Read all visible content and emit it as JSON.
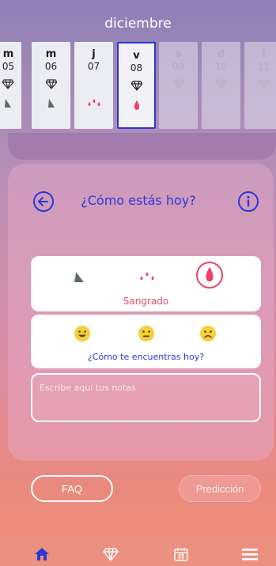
{
  "header": {
    "month": "diciembre"
  },
  "days": [
    {
      "name": "m",
      "num": "05",
      "state": "past",
      "icon": "diamond-icon",
      "mark": "leaf-drop-icon"
    },
    {
      "name": "m",
      "num": "06",
      "state": "past",
      "icon": "diamond-icon",
      "mark": "leaf-drop-icon"
    },
    {
      "name": "j",
      "num": "07",
      "state": "past",
      "icon": "",
      "mark": "blood-drops-icon"
    },
    {
      "name": "v",
      "num": "08",
      "state": "selected",
      "icon": "diamond-icon",
      "mark": "blood-drop-icon"
    },
    {
      "name": "s",
      "num": "09",
      "state": "future",
      "icon": "diamond-icon",
      "mark": ""
    },
    {
      "name": "d",
      "num": "10",
      "state": "future",
      "icon": "diamond-icon",
      "mark": ""
    },
    {
      "name": "l",
      "num": "11",
      "state": "future",
      "icon": "diamond-icon",
      "mark": ""
    }
  ],
  "main": {
    "title": "¿Cómo estás hoy?",
    "bleeding": {
      "label": "Sangrado",
      "options": [
        "spotting-icon",
        "light-bleeding-icon",
        "heavy-bleeding-icon"
      ],
      "selected": 2
    },
    "mood": {
      "label": "¿Cómo te encuentras hoy?",
      "options": [
        "happy-face-icon",
        "neutral-face-icon",
        "sad-face-icon"
      ]
    },
    "notes_placeholder": "Escribe aquí tus notas"
  },
  "buttons": {
    "faq": "FAQ",
    "prediction": "Predicción"
  },
  "tabbar": {
    "items": [
      "home-icon",
      "diamond-icon",
      "calendar-icon",
      "menu-icon"
    ],
    "active": 0
  },
  "colors": {
    "accent": "#2a39d6",
    "blood": "#f03e66",
    "selected_border": "#2636d8",
    "bleed_label": "#e3486c",
    "mood_label": "#2a39d6"
  }
}
